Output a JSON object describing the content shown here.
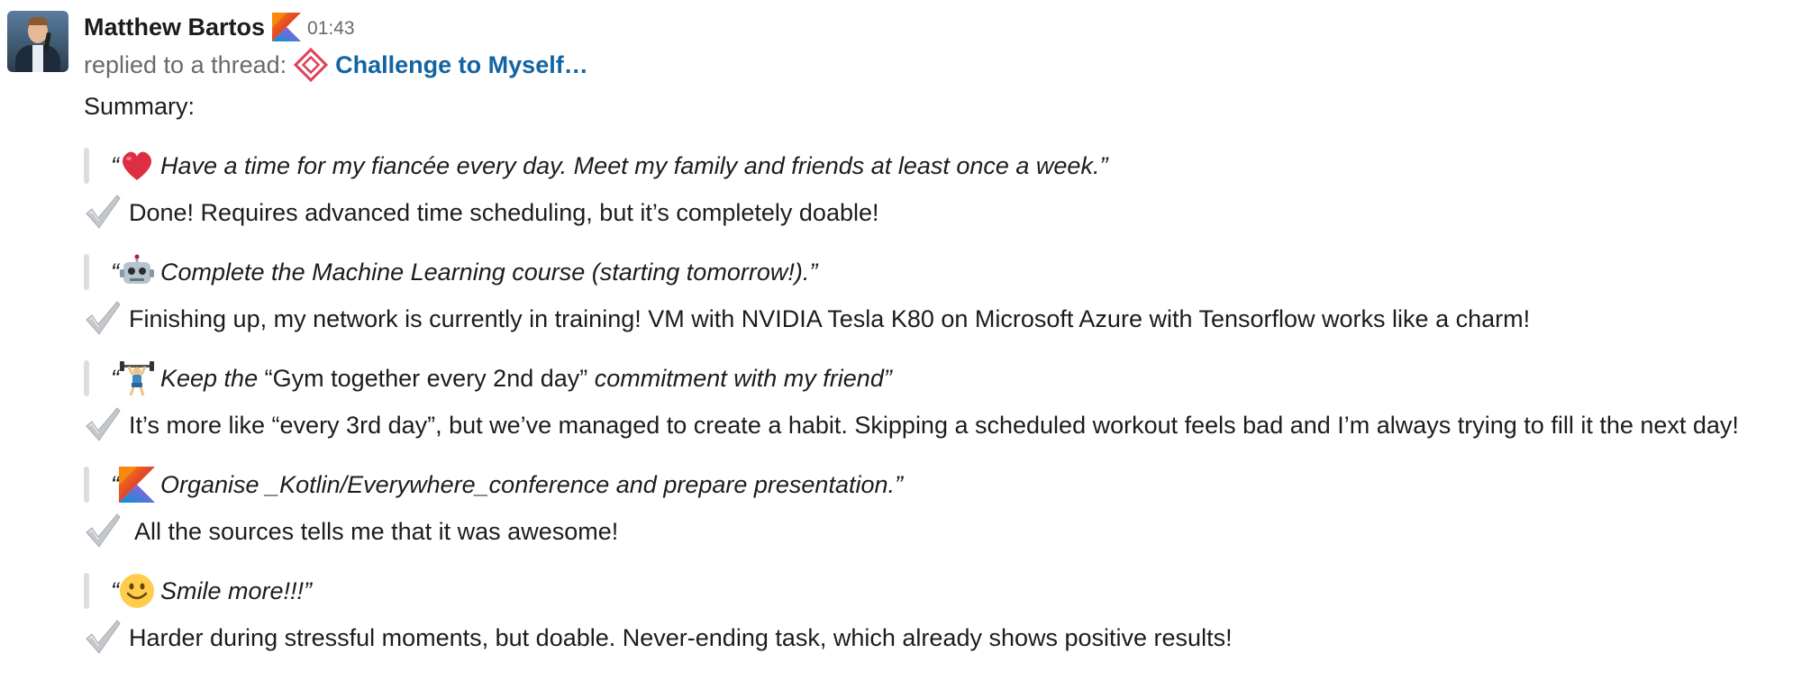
{
  "message": {
    "author": "Matthew Bartos",
    "time": "01:43",
    "thread_prefix": "replied to a thread:",
    "thread_title": "Challenge to Myself…",
    "summary_label": "Summary:",
    "items": [
      {
        "emoji": "heart",
        "quote_parts": [
          {
            "text": "Have a time for my fiancée every day. Meet my family and friends at least once a week.",
            "italic": true
          }
        ],
        "answer": "Done! Requires advanced time scheduling, but it’s completely doable!"
      },
      {
        "emoji": "robot",
        "quote_parts": [
          {
            "text": "Complete the Machine Learning course (starting tomorrow!).",
            "italic": true
          }
        ],
        "answer": "Finishing up, my network is currently in training! VM with NVIDIA Tesla K80 on Microsoft Azure with Tensorflow works like a charm!"
      },
      {
        "emoji": "weightlifter",
        "quote_parts": [
          {
            "text": "Keep the ",
            "italic": true
          },
          {
            "text": "“Gym together every 2nd day”",
            "italic": false
          },
          {
            "text": " commitment with my friend",
            "italic": true
          }
        ],
        "answer": "It’s more like “every 3rd day”, but we’ve managed to create a habit. Skipping a scheduled workout feels bad and I’m always trying to fill it the next day!"
      },
      {
        "emoji": "kotlin",
        "quote_parts": [
          {
            "text": "Organise _Kotlin/Everywhere_conference and prepare presentation.",
            "italic": true
          }
        ],
        "answer": " All the sources tells me that it was awesome!"
      },
      {
        "emoji": "smile",
        "quote_parts": [
          {
            "text": "Smile more!!!",
            "italic": true
          }
        ],
        "answer": "Harder during stressful moments, but doable. Never-ending task, which already shows positive results!"
      }
    ]
  },
  "colors": {
    "link": "#1264a3",
    "muted": "#696969",
    "quote_bar": "#dddddd",
    "text": "#1d1c1d"
  },
  "icons": {
    "check": "heavy-check-mark-icon",
    "badge": "kotlin-logo-icon",
    "thread": "diamond-logo-icon"
  }
}
